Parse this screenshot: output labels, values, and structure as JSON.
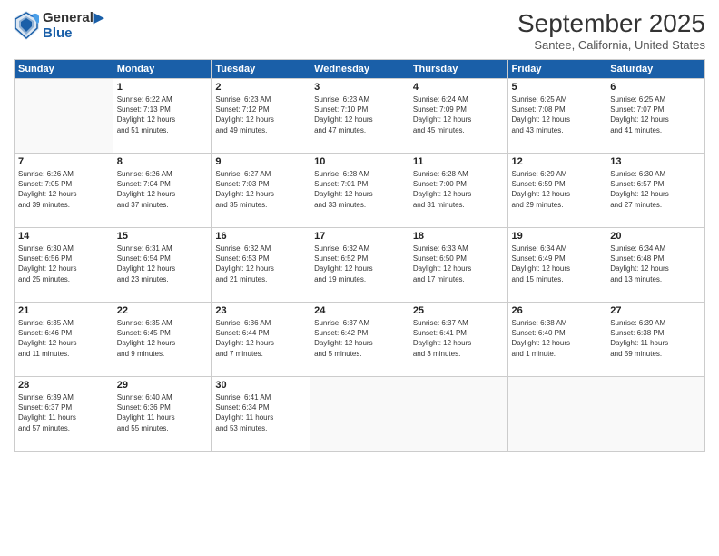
{
  "logo": {
    "line1": "General",
    "line2": "Blue"
  },
  "title": "September 2025",
  "location": "Santee, California, United States",
  "days_header": [
    "Sunday",
    "Monday",
    "Tuesday",
    "Wednesday",
    "Thursday",
    "Friday",
    "Saturday"
  ],
  "weeks": [
    [
      {
        "num": "",
        "info": ""
      },
      {
        "num": "1",
        "info": "Sunrise: 6:22 AM\nSunset: 7:13 PM\nDaylight: 12 hours\nand 51 minutes."
      },
      {
        "num": "2",
        "info": "Sunrise: 6:23 AM\nSunset: 7:12 PM\nDaylight: 12 hours\nand 49 minutes."
      },
      {
        "num": "3",
        "info": "Sunrise: 6:23 AM\nSunset: 7:10 PM\nDaylight: 12 hours\nand 47 minutes."
      },
      {
        "num": "4",
        "info": "Sunrise: 6:24 AM\nSunset: 7:09 PM\nDaylight: 12 hours\nand 45 minutes."
      },
      {
        "num": "5",
        "info": "Sunrise: 6:25 AM\nSunset: 7:08 PM\nDaylight: 12 hours\nand 43 minutes."
      },
      {
        "num": "6",
        "info": "Sunrise: 6:25 AM\nSunset: 7:07 PM\nDaylight: 12 hours\nand 41 minutes."
      }
    ],
    [
      {
        "num": "7",
        "info": "Sunrise: 6:26 AM\nSunset: 7:05 PM\nDaylight: 12 hours\nand 39 minutes."
      },
      {
        "num": "8",
        "info": "Sunrise: 6:26 AM\nSunset: 7:04 PM\nDaylight: 12 hours\nand 37 minutes."
      },
      {
        "num": "9",
        "info": "Sunrise: 6:27 AM\nSunset: 7:03 PM\nDaylight: 12 hours\nand 35 minutes."
      },
      {
        "num": "10",
        "info": "Sunrise: 6:28 AM\nSunset: 7:01 PM\nDaylight: 12 hours\nand 33 minutes."
      },
      {
        "num": "11",
        "info": "Sunrise: 6:28 AM\nSunset: 7:00 PM\nDaylight: 12 hours\nand 31 minutes."
      },
      {
        "num": "12",
        "info": "Sunrise: 6:29 AM\nSunset: 6:59 PM\nDaylight: 12 hours\nand 29 minutes."
      },
      {
        "num": "13",
        "info": "Sunrise: 6:30 AM\nSunset: 6:57 PM\nDaylight: 12 hours\nand 27 minutes."
      }
    ],
    [
      {
        "num": "14",
        "info": "Sunrise: 6:30 AM\nSunset: 6:56 PM\nDaylight: 12 hours\nand 25 minutes."
      },
      {
        "num": "15",
        "info": "Sunrise: 6:31 AM\nSunset: 6:54 PM\nDaylight: 12 hours\nand 23 minutes."
      },
      {
        "num": "16",
        "info": "Sunrise: 6:32 AM\nSunset: 6:53 PM\nDaylight: 12 hours\nand 21 minutes."
      },
      {
        "num": "17",
        "info": "Sunrise: 6:32 AM\nSunset: 6:52 PM\nDaylight: 12 hours\nand 19 minutes."
      },
      {
        "num": "18",
        "info": "Sunrise: 6:33 AM\nSunset: 6:50 PM\nDaylight: 12 hours\nand 17 minutes."
      },
      {
        "num": "19",
        "info": "Sunrise: 6:34 AM\nSunset: 6:49 PM\nDaylight: 12 hours\nand 15 minutes."
      },
      {
        "num": "20",
        "info": "Sunrise: 6:34 AM\nSunset: 6:48 PM\nDaylight: 12 hours\nand 13 minutes."
      }
    ],
    [
      {
        "num": "21",
        "info": "Sunrise: 6:35 AM\nSunset: 6:46 PM\nDaylight: 12 hours\nand 11 minutes."
      },
      {
        "num": "22",
        "info": "Sunrise: 6:35 AM\nSunset: 6:45 PM\nDaylight: 12 hours\nand 9 minutes."
      },
      {
        "num": "23",
        "info": "Sunrise: 6:36 AM\nSunset: 6:44 PM\nDaylight: 12 hours\nand 7 minutes."
      },
      {
        "num": "24",
        "info": "Sunrise: 6:37 AM\nSunset: 6:42 PM\nDaylight: 12 hours\nand 5 minutes."
      },
      {
        "num": "25",
        "info": "Sunrise: 6:37 AM\nSunset: 6:41 PM\nDaylight: 12 hours\nand 3 minutes."
      },
      {
        "num": "26",
        "info": "Sunrise: 6:38 AM\nSunset: 6:40 PM\nDaylight: 12 hours\nand 1 minute."
      },
      {
        "num": "27",
        "info": "Sunrise: 6:39 AM\nSunset: 6:38 PM\nDaylight: 11 hours\nand 59 minutes."
      }
    ],
    [
      {
        "num": "28",
        "info": "Sunrise: 6:39 AM\nSunset: 6:37 PM\nDaylight: 11 hours\nand 57 minutes."
      },
      {
        "num": "29",
        "info": "Sunrise: 6:40 AM\nSunset: 6:36 PM\nDaylight: 11 hours\nand 55 minutes."
      },
      {
        "num": "30",
        "info": "Sunrise: 6:41 AM\nSunset: 6:34 PM\nDaylight: 11 hours\nand 53 minutes."
      },
      {
        "num": "",
        "info": ""
      },
      {
        "num": "",
        "info": ""
      },
      {
        "num": "",
        "info": ""
      },
      {
        "num": "",
        "info": ""
      }
    ]
  ]
}
